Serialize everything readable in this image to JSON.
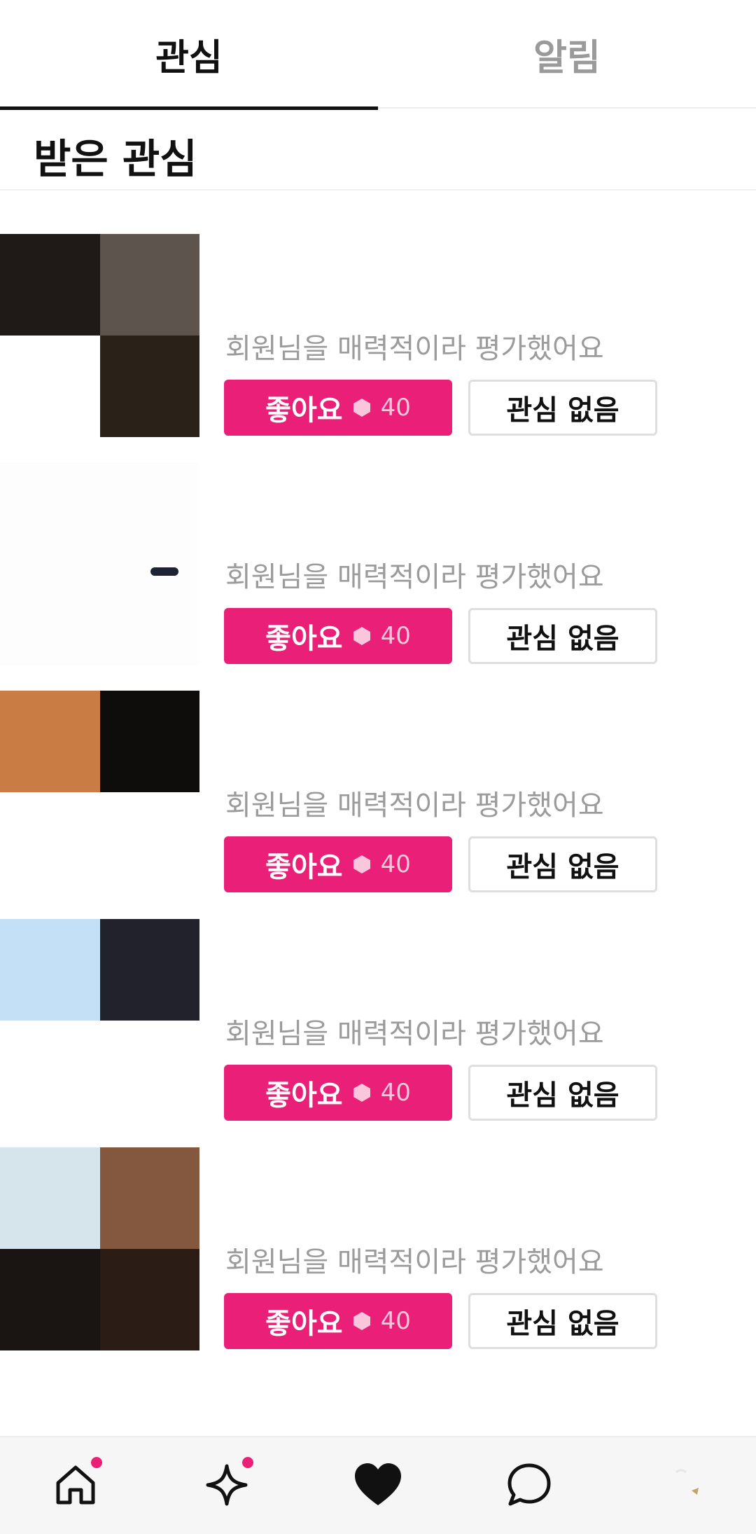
{
  "tabs": [
    {
      "label": "관심",
      "active": true
    },
    {
      "label": "알림",
      "active": false
    }
  ],
  "section_title": "받은 관심",
  "items": [
    {
      "name": "",
      "description": "회원님을 매력적이라 평가했어요",
      "like_label": "좋아요",
      "like_cost": "40",
      "pass_label": "관심 없음"
    },
    {
      "name": "",
      "description": "회원님을 매력적이라 평가했어요",
      "like_label": "좋아요",
      "like_cost": "40",
      "pass_label": "관심 없음"
    },
    {
      "name": "",
      "description": "회원님을 매력적이라 평가했어요",
      "like_label": "좋아요",
      "like_cost": "40",
      "pass_label": "관심 없음"
    },
    {
      "name": "",
      "description": "회원님을 매력적이라 평가했어요",
      "like_label": "좋아요",
      "like_cost": "40",
      "pass_label": "관심 없음"
    },
    {
      "name": "",
      "description": "회원님을 매력적이라 평가했어요",
      "like_label": "좋아요",
      "like_cost": "40",
      "pass_label": "관심 없음"
    }
  ],
  "bottom_nav": [
    {
      "icon": "home-icon",
      "badge": true
    },
    {
      "icon": "sparkle-icon",
      "badge": true
    },
    {
      "icon": "heart-icon",
      "badge": false
    },
    {
      "icon": "chat-icon",
      "badge": false
    },
    {
      "icon": "profile-avatar",
      "badge": false
    }
  ],
  "colors": {
    "accent": "#ea1f78",
    "text": "#111111",
    "muted": "#9b9b9b",
    "border": "#dedede"
  }
}
